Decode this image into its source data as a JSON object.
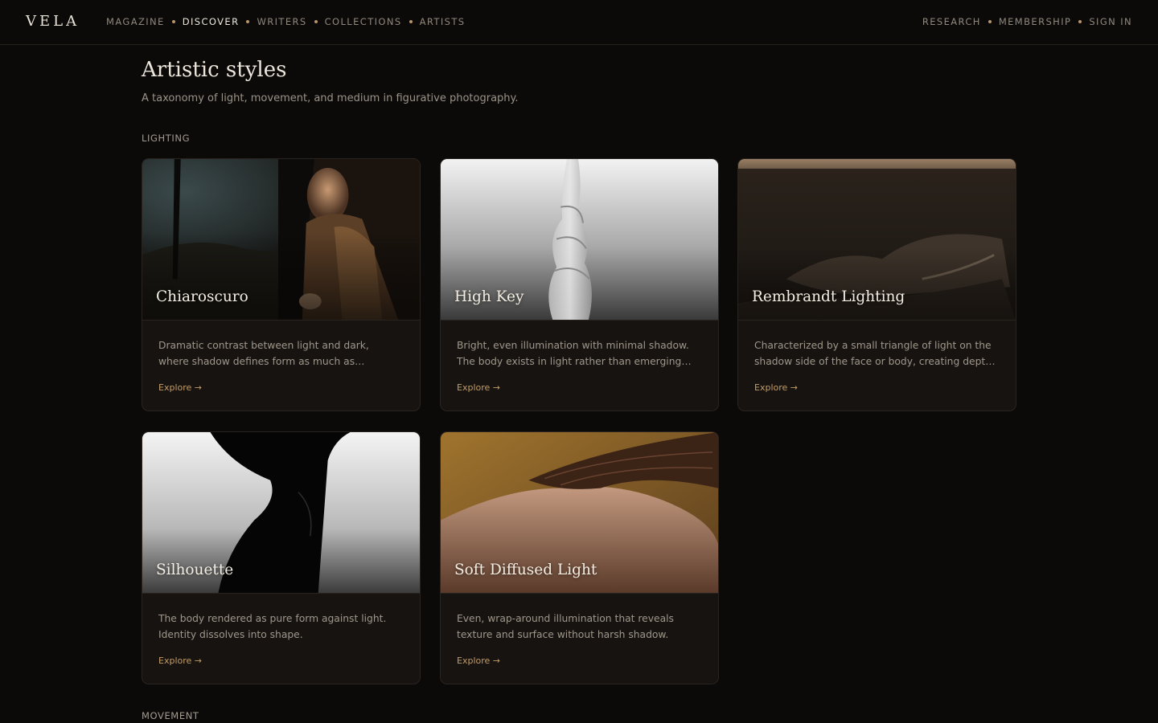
{
  "brand": {
    "logo": "VELA"
  },
  "nav": {
    "left": [
      {
        "label": "Magazine",
        "active": false
      },
      {
        "label": "Discover",
        "active": true
      },
      {
        "label": "Writers",
        "active": false
      },
      {
        "label": "Collections",
        "active": false
      },
      {
        "label": "Artists",
        "active": false
      }
    ],
    "right": [
      {
        "label": "Research"
      },
      {
        "label": "Membership"
      },
      {
        "label": "Sign in"
      }
    ]
  },
  "page": {
    "title": "Artistic styles",
    "subtitle": "A taxonomy of light, movement, and medium in figurative photography."
  },
  "sections": [
    {
      "label": "Lighting",
      "cards": [
        {
          "title": "Chiaroscuro",
          "description": "Dramatic contrast between light and dark, where shadow defines form as much as illumination.",
          "link": "Explore →",
          "image": "chiaroscuro-painting"
        },
        {
          "title": "High Key",
          "description": "Bright, even illumination with minimal shadow. The body exists in light rather than emerging from shadow.",
          "link": "Explore →",
          "image": "high-key-figure"
        },
        {
          "title": "Rembrandt Lighting",
          "description": "Characterized by a small triangle of light on the shadow side of the face or body, creating depth and form.",
          "link": "Explore →",
          "image": "rembrandt-etching"
        },
        {
          "title": "Silhouette",
          "description": "The body rendered as pure form against light. Identity dissolves into shape.",
          "link": "Explore →",
          "image": "silhouette-figure"
        },
        {
          "title": "Soft Diffused Light",
          "description": "Even, wrap-around illumination that reveals texture and surface without harsh shadow.",
          "link": "Explore →",
          "image": "soft-light-shoulder"
        }
      ]
    },
    {
      "label": "Movement",
      "cards": []
    }
  ]
}
